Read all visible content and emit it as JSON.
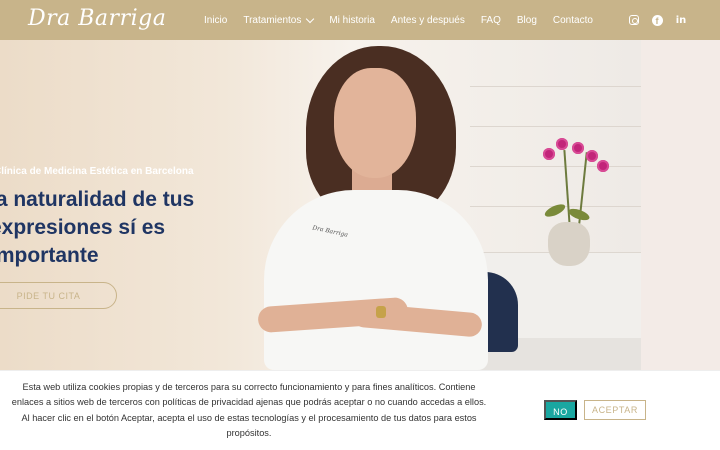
{
  "header": {
    "logo_text": "Dra Barriga",
    "nav": [
      {
        "label": "Inicio"
      },
      {
        "label": "Tratamientos",
        "has_dropdown": true
      },
      {
        "label": "Mi historia"
      },
      {
        "label": "Antes y después"
      },
      {
        "label": "FAQ"
      },
      {
        "label": "Blog"
      },
      {
        "label": "Contacto"
      }
    ],
    "social": {
      "facebook_glyph": "f",
      "linkedin_glyph": "in"
    },
    "social_icons": [
      "instagram-icon",
      "facebook-icon",
      "linkedin-icon"
    ],
    "background_color": "#c8b48a"
  },
  "hero": {
    "subtitle": "Clínica de Medicina Estética en Barcelona",
    "headline_lines": [
      "la naturalidad de tus",
      "expresiones sí es",
      "importante"
    ],
    "cta_label": "PIDE TU CITA",
    "coat_logo": "Dra Barriga",
    "headline_color": "#1f3563",
    "accent_color": "#c8b48a"
  },
  "cookie_banner": {
    "text": "Esta web utiliza cookies propias y de terceros para su correcto funcionamiento y para fines analíticos. Contiene enlaces a sitios web de terceros con políticas de privacidad ajenas que podrás aceptar o no cuando accedas a ellos. Al hacer clic en el botón Aceptar, acepta el uso de estas tecnologías y el procesamiento de tus datos para estos propósitos.",
    "reject_label": "NO",
    "accept_label": "ACEPTAR",
    "reject_color": "#1aa7a1"
  }
}
